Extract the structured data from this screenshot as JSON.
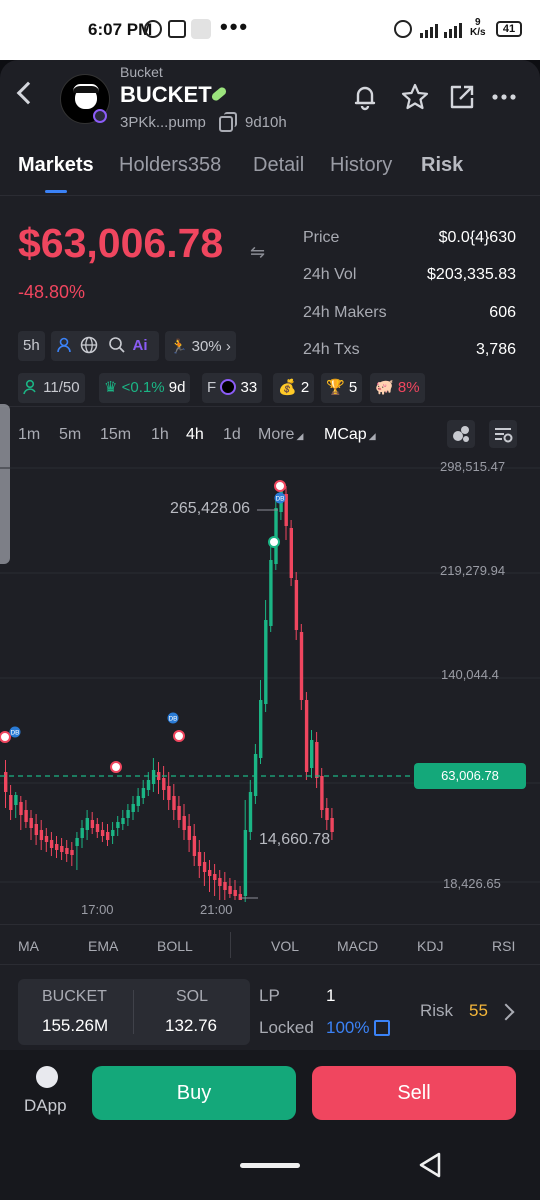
{
  "statusbar": {
    "time": "6:07 PM",
    "net_speed": "9",
    "net_unit": "K/s",
    "battery": "41"
  },
  "header": {
    "chain_label": "Bucket",
    "token_name": "BUCKET",
    "address": "3PKk...pump",
    "age": "9d10h"
  },
  "tabs": [
    "Markets",
    "Holders358",
    "Detail",
    "History",
    "Risk"
  ],
  "price": {
    "big_value": "$63,006.78",
    "change": "-48.80%",
    "stats": [
      {
        "label": "Price",
        "value": "$0.0{4}630"
      },
      {
        "label": "24h Vol",
        "value": "$203,335.83"
      },
      {
        "label": "24h Makers",
        "value": "606"
      },
      {
        "label": "24h Txs",
        "value": "3,786"
      }
    ]
  },
  "chips_row1": {
    "time": "5h",
    "ai": "Ai",
    "pace": "30%"
  },
  "chips_row2": {
    "holders": "11/50",
    "top_hold": "<0.1%",
    "top_hold_age": "9d",
    "f_label": "F",
    "f_count": "33",
    "bag_count": "2",
    "trophy_count": "5",
    "rug_pct": "8%"
  },
  "timeframes": [
    "1m",
    "5m",
    "15m",
    "1h",
    "4h",
    "1d"
  ],
  "active_timeframe": "4h",
  "more_label": "More",
  "mcap_label": "MCap",
  "chart_data": {
    "type": "candlestick",
    "y_ticks": [
      "298,515.47",
      "219,279.94",
      "140,044.4",
      "63,006.78",
      "18,426.65"
    ],
    "x_ticks": [
      "17:00",
      "21:00"
    ],
    "high_annotation": "265,428.06",
    "low_annotation": "14,660.78",
    "current_value": "63,006.78",
    "marker_label": "DB",
    "up_color": "#1bb585",
    "down_color": "#f0465f"
  },
  "indicators": [
    "MA",
    "EMA",
    "BOLL",
    "VOL",
    "MACD",
    "KDJ",
    "RSI"
  ],
  "liquidity": {
    "base_label": "BUCKET",
    "base_value": "155.26M",
    "quote_label": "SOL",
    "quote_value": "132.76",
    "lp_label": "LP",
    "lp_value": "1",
    "locked_label": "Locked",
    "locked_value": "100%",
    "risk_label": "Risk",
    "risk_value": "55"
  },
  "bottom": {
    "dapp_label": "DApp",
    "buy_label": "Buy",
    "sell_label": "Sell"
  },
  "colors": {
    "accent": "#3b82f6",
    "down": "#f0465f",
    "up": "#14a87a",
    "warning": "#f5b73a"
  }
}
